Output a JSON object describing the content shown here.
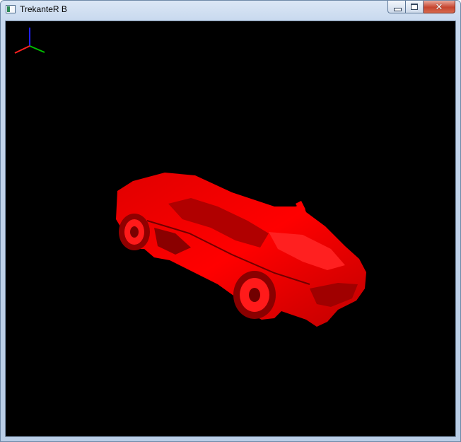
{
  "window": {
    "title": "TrekanteR B",
    "close_glyph": "✕"
  },
  "icons": {
    "app": "application-icon",
    "minimize": "minimize-icon",
    "maximize": "maximize-icon",
    "close": "close-icon"
  },
  "viewport": {
    "background": "#000000",
    "model_color": "#ff0000",
    "axis_colors": {
      "x": "#00c000",
      "y": "#2020ff",
      "z": "#ff2020"
    }
  }
}
